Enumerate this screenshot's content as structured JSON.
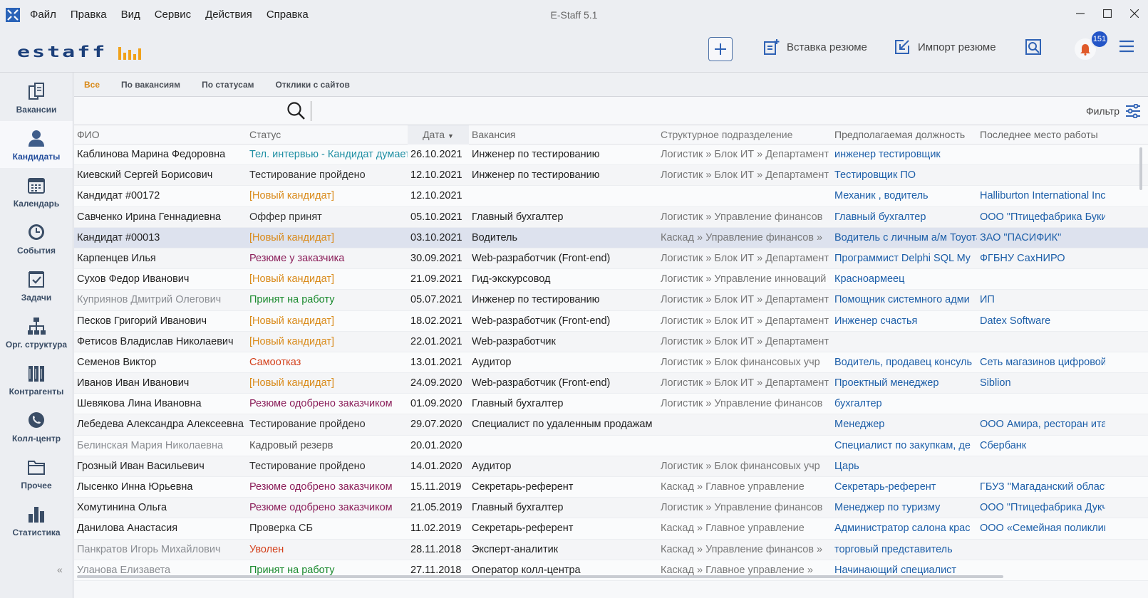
{
  "window": {
    "title": "E-Staff 5.1",
    "menu": [
      "Файл",
      "Правка",
      "Вид",
      "Сервис",
      "Действия",
      "Справка"
    ]
  },
  "header": {
    "logo_text": "estaff",
    "insert_resume": "Вставка резюме",
    "import_resume": "Импорт резюме",
    "notifications_count": "151"
  },
  "sidebar": {
    "items": [
      {
        "label": "Вакансии",
        "icon": "vacancies-icon"
      },
      {
        "label": "Кандидаты",
        "icon": "candidates-icon",
        "active": true
      },
      {
        "label": "Календарь",
        "icon": "calendar-icon"
      },
      {
        "label": "События",
        "icon": "events-icon"
      },
      {
        "label": "Задачи",
        "icon": "tasks-icon"
      },
      {
        "label": "Орг. структура",
        "icon": "org-structure-icon"
      },
      {
        "label": "Контрагенты",
        "icon": "contractors-icon"
      },
      {
        "label": "Колл-центр",
        "icon": "call-center-icon"
      },
      {
        "label": "Прочее",
        "icon": "other-icon"
      },
      {
        "label": "Статистика",
        "icon": "statistics-icon"
      }
    ]
  },
  "tabs": [
    "Все",
    "По вакансиям",
    "По статусам",
    "Отклики с сайтов"
  ],
  "search": {
    "placeholder": ""
  },
  "filter_label": "Фильтр",
  "colors": {
    "accent": "#d98a1a",
    "link": "#1c5ea8",
    "brand": "#1b3f7a"
  },
  "table": {
    "columns": [
      "ФИО",
      "Статус",
      "Дата",
      "Вакансия",
      "Структурное подразделение",
      "Предполагаемая должность",
      "Последнее место работы"
    ],
    "sorted_column": "Дата",
    "rows": [
      {
        "name": "Каблинова Марина Федоровна",
        "status": "Тел. интервью - Кандидат думает",
        "st": "teal",
        "date": "26.10.2021",
        "vacancy": "Инженер по тестированию",
        "dept": "Логистик  »  Блок ИТ  »  Департамент",
        "position": "инженер тестировщик",
        "last": ""
      },
      {
        "name": "Киевский Сергей Борисович",
        "status": "Тестирование пройдено",
        "st": "dark",
        "date": "12.10.2021",
        "vacancy": "Инженер по тестированию",
        "dept": "Логистик  »  Блок ИТ  »  Департамент",
        "position": "Тестировщик ПО",
        "last": ""
      },
      {
        "name": "Кандидат #00172",
        "status": "[Новый кандидат]",
        "st": "orange",
        "date": "12.10.2021",
        "vacancy": "",
        "dept": "",
        "position": "Механик , водитель",
        "last": "Halliburton International Inc"
      },
      {
        "name": "Савченко Ирина Геннадиевна",
        "status": "Оффер принят",
        "st": "dark",
        "date": "05.10.2021",
        "vacancy": "Главный бухгалтер",
        "dept": "Логистик  »  Управление финансов",
        "position": "Главный бухгалтер",
        "last": "ООО \"Птицефабрика Букин"
      },
      {
        "name": "Кандидат #00013",
        "status": "[Новый кандидат]",
        "st": "orange",
        "date": "03.10.2021",
        "vacancy": "Водитель",
        "dept": "Каскад  »  Управление финансов  »",
        "position": "Водитель с личным а/м Тоуота",
        "last": "ЗАО \"ПАСИФИК\"",
        "selected": true
      },
      {
        "name": "Карпенцев Илья",
        "status": "Резюме у заказчика",
        "st": "purple",
        "date": "30.09.2021",
        "vacancy": "Web-разработчик (Front-end)",
        "dept": "Логистик  »  Блок ИТ  »  Департамент",
        "position": "Программист Delphi SQL My",
        "last": "ФГБНУ СахНИРО"
      },
      {
        "name": "Сухов Федор Иванович",
        "status": "[Новый кандидат]",
        "st": "orange",
        "date": "21.09.2021",
        "vacancy": "Гид-экскурсовод",
        "dept": "Логистик  »  Управление инноваций",
        "position": "Красноармеец",
        "last": ""
      },
      {
        "name": "Куприянов Дмитрий Олегович",
        "status": "Принят на работу",
        "st": "green",
        "date": "05.07.2021",
        "vacancy": "Инженер по тестированию",
        "dept": "Логистик  »  Блок ИТ  »  Департамент",
        "position": "Помощник системного адми",
        "last": "ИП",
        "muted": true
      },
      {
        "name": "Песков Григорий Иванович",
        "status": "[Новый кандидат]",
        "st": "orange",
        "date": "18.02.2021",
        "vacancy": "Web-разработчик (Front-end)",
        "dept": "Логистик  »  Блок ИТ  »  Департамент",
        "position": "Инженер счастья",
        "last": "Datex Software"
      },
      {
        "name": "Фетисов Владислав Николаевич",
        "status": "[Новый кандидат]",
        "st": "orange",
        "date": "22.01.2021",
        "vacancy": "Web-разработчик",
        "dept": "Логистик  »  Блок ИТ  »  Департамент",
        "position": "",
        "last": ""
      },
      {
        "name": "Семенов Виктор",
        "status": "Самоотказ",
        "st": "red",
        "date": "13.01.2021",
        "vacancy": "Аудитор",
        "dept": "Логистик  »  Блок финансовых учр",
        "position": "Водитель, продавец консуль",
        "last": "Сеть магазинов цифровой"
      },
      {
        "name": "Иванов Иван Иванович",
        "status": "[Новый кандидат]",
        "st": "orange",
        "date": "24.09.2020",
        "vacancy": "Web-разработчик (Front-end)",
        "dept": "Логистик  »  Блок ИТ  »  Департамент",
        "position": "Проектный менеджер",
        "last": "Siblion"
      },
      {
        "name": "Шевякова Лина Ивановна",
        "status": "Резюме одобрено заказчиком",
        "st": "purple",
        "date": "01.09.2020",
        "vacancy": "Главный бухгалтер",
        "dept": "Логистик  »  Управление финансов",
        "position": "бухгалтер",
        "last": ""
      },
      {
        "name": "Лебедева Александра Алексеевна",
        "status": "Тестирование пройдено",
        "st": "dark",
        "date": "29.07.2020",
        "vacancy": "Специалист по удаленным продажам",
        "dept": "",
        "position": "Менеджер",
        "last": "ООО Амира, ресторан ита"
      },
      {
        "name": "Белинская Мария Николаевна",
        "status": "Кадровый резерв",
        "st": "gray",
        "date": "20.01.2020",
        "vacancy": "",
        "dept": "",
        "position": "Специалист по закупкам, де",
        "last": "Сбербанк",
        "muted": true
      },
      {
        "name": "Грозный Иван Васильевич",
        "status": "Тестирование пройдено",
        "st": "dark",
        "date": "14.01.2020",
        "vacancy": "Аудитор",
        "dept": "Логистик  »  Блок финансовых учр",
        "position": "Царь",
        "last": ""
      },
      {
        "name": "Лысенко Инна Юрьевна",
        "status": "Резюме одобрено заказчиком",
        "st": "purple",
        "date": "15.11.2019",
        "vacancy": "Секретарь-референт",
        "dept": "Каскад  »  Главное управление",
        "position": "Секретарь-референт",
        "last": "ГБУЗ \"Магаданский област"
      },
      {
        "name": "Хомутинина Ольга",
        "status": "Резюме одобрено заказчиком",
        "st": "purple",
        "date": "21.05.2019",
        "vacancy": "Главный бухгалтер",
        "dept": "Логистик  »  Управление финансов",
        "position": "Менеджер по туризму",
        "last": "ООО \"Птицефабрика Дукч"
      },
      {
        "name": "Данилова Анастасия",
        "status": "Проверка СБ",
        "st": "dark",
        "date": "11.02.2019",
        "vacancy": "Секретарь-референт",
        "dept": "Каскад  »  Главное управление",
        "position": "Администратор салона крас",
        "last": "ООО «Семейная поликлин"
      },
      {
        "name": "Панкратов Игорь Михайлович",
        "status": "Уволен",
        "st": "red",
        "date": "28.11.2018",
        "vacancy": "Эксперт-аналитик",
        "dept": "Каскад  »  Управление финансов  »",
        "position": "торговый представитель",
        "last": "",
        "muted": true
      },
      {
        "name": "Уланова Елизавета",
        "status": "Принят на работу",
        "st": "green",
        "date": "27.11.2018",
        "vacancy": "Оператор колл-центра",
        "dept": "Каскад  »  Главное управление  »",
        "position": "Начинающий специалист",
        "last": "",
        "muted": true
      }
    ]
  }
}
